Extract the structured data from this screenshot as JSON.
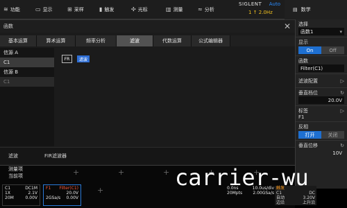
{
  "menu": [
    {
      "icon": "≋",
      "label": "功能",
      "icon_name": "function-icon",
      "w": 46
    },
    {
      "icon": "▭",
      "label": "显示",
      "icon_name": "display-icon",
      "w": 46
    },
    {
      "icon": "⊞",
      "label": "采样",
      "icon_name": "acquire-icon",
      "w": 46
    },
    {
      "icon": "▮",
      "label": "触发",
      "icon_name": "trigger-icon",
      "w": 46
    },
    {
      "icon": "✣",
      "label": "光标",
      "icon_name": "cursor-icon",
      "w": 50
    },
    {
      "icon": "▥",
      "label": "测量",
      "icon_name": "measure-icon",
      "w": 46
    },
    {
      "icon": "≈",
      "label": "分析",
      "icon_name": "analysis-icon",
      "w": 56
    }
  ],
  "brand": {
    "logo": "SIGLENT",
    "mode": "Auto",
    "rate": "1 ↑ 2.0Hz"
  },
  "right_top": {
    "label": "数学"
  },
  "dialog": {
    "title": "函数",
    "tabs": [
      "基本运算",
      "算术运算",
      "频率分析",
      "滤波",
      "代数运算",
      "公式编辑器"
    ],
    "active_tab": 3,
    "left_list": [
      {
        "label": "信源 A",
        "state": "normal"
      },
      {
        "label": "C1",
        "state": "sel"
      },
      {
        "label": "信源 B",
        "state": "normal"
      },
      {
        "label": "C1",
        "state": "dim"
      }
    ],
    "chip_box": "FR",
    "chip_blue": "滤波",
    "bottom": [
      "滤波",
      "FIR滤波器"
    ]
  },
  "rpanel": {
    "trace_label": "选择",
    "trace_value": "函数1",
    "display_label": "显示",
    "on": "On",
    "off": "Off",
    "func_label": "函数",
    "func_value": "Filter(C1)",
    "filter_config": "滤波配置",
    "vertical_scale_label": "垂直档位",
    "vertical_scale_value": "20.0V",
    "label_label": "标签",
    "label_value": "F1",
    "invert_label": "反相",
    "invert_on": "打开",
    "invert_off": "关闭",
    "vertical_pos_label": "垂直位移",
    "vertical_pos_value": "10V"
  },
  "status": {
    "meas_title": "测量项",
    "meas_sub": "当前项",
    "ch1": {
      "name": "C1",
      "coupling": "DC1M",
      "probe": "1X",
      "scale": "2.1V",
      "bw": "20M",
      "offset": "0.00V"
    },
    "f1": {
      "name": "F1",
      "func": "Filter(C1)",
      "scale": "20.0V",
      "rate": "2GSa/s",
      "offset": "0.00V"
    },
    "timebase": {
      "t1": "0.0ns",
      "t2": "10.0us/div",
      "t3": "20Mpts",
      "t4": "2.00GSa/s"
    },
    "trigger": {
      "title": "触发",
      "r1a": "C1",
      "r1b": "DC",
      "r2a": "自动",
      "r2b": "3.20V",
      "r3a": "边沿",
      "r3b": "上升沿"
    }
  },
  "watermark": "carrier-wu"
}
